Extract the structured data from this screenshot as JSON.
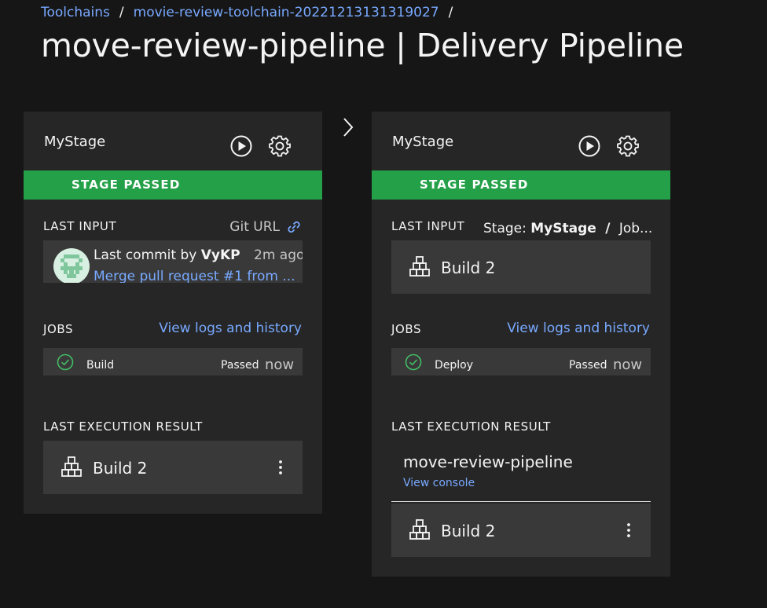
{
  "breadcrumb": {
    "items": [
      "Toolchains",
      "movie-review-toolchain-20221213131319027"
    ],
    "separator": "/"
  },
  "page": {
    "title": "move-review-pipeline | Delivery Pipeline"
  },
  "colors": {
    "accent": "#78a9ff",
    "success": "#24a148",
    "card": "#262626",
    "tile": "#393939",
    "background": "#161616"
  },
  "stages": [
    {
      "name": "MyStage",
      "status": "STAGE PASSED",
      "last_input": {
        "label": "LAST INPUT",
        "source_label": "Git URL",
        "commit_prefix": "Last commit by",
        "commit_author": "VyKP",
        "commit_time": "2m ago",
        "commit_message": "Merge pull request #1 from ..."
      },
      "jobs": {
        "label": "JOBS",
        "view_logs": "View logs and history",
        "items": [
          {
            "name": "Build",
            "status": "Passed",
            "time": "now"
          }
        ]
      },
      "last_execution": {
        "label": "LAST EXECUTION RESULT",
        "build_label": "Build 2"
      }
    },
    {
      "name": "MyStage",
      "status": "STAGE PASSED",
      "last_input": {
        "label": "LAST INPUT",
        "stage_prefix": "Stage:",
        "stage_name": "MyStage",
        "stage_sep": "/",
        "job_suffix": "Job...",
        "build_label": "Build 2"
      },
      "jobs": {
        "label": "JOBS",
        "view_logs": "View logs and history",
        "items": [
          {
            "name": "Deploy",
            "status": "Passed",
            "time": "now"
          }
        ]
      },
      "last_execution": {
        "label": "LAST EXECUTION RESULT",
        "pipeline_name": "move-review-pipeline",
        "view_console": "View console",
        "build_label": "Build 2"
      }
    }
  ],
  "icons": [
    "play-icon",
    "gear-icon",
    "link-icon",
    "check-circle-icon",
    "build-icon",
    "overflow-menu-icon",
    "chevron-right-icon"
  ]
}
